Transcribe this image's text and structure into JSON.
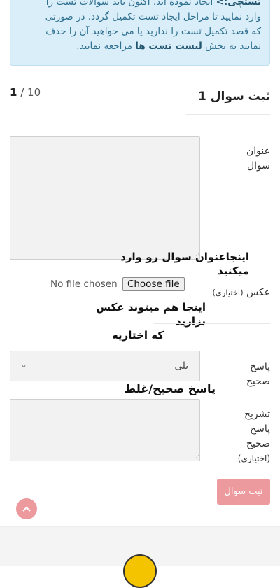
{
  "alert": {
    "line1_bold": "تستچی:>",
    "line1_rest": " ایجاد نموده اید. اکنون باید سوالات تست را",
    "line2": "وارد نمایید تا مراحل ایجاد تست تکمیل گردد. در صورتی",
    "line3": "که قصد تکمیل تست را ندارید یا می خواهید آن را حذف",
    "line4_pre": "نمایید به بخش ",
    "line4_bold": "لیست تست ها",
    "line4_post": " مراجعه نمایید."
  },
  "header": {
    "title": "ثبت سوال 1",
    "pager_total": "10",
    "pager_sep": " / ",
    "pager_current": "1"
  },
  "form": {
    "question_label_1": "عنوان",
    "question_label_2": "سوال",
    "image_label": "عکس",
    "image_label_optional": "(اختیاری)",
    "file_status": "No file chosen",
    "file_button": "Choose file",
    "answer_label_1": "پاسخ",
    "answer_label_2": "صحیح",
    "answer_selected": "بلی",
    "explain_label_1": "تشریح",
    "explain_label_2": "پاسخ",
    "explain_label_3": "صحیح",
    "explain_label_4": "(اختیاری)",
    "submit_label": "ثبت سوال"
  },
  "annotations": {
    "title_note": "اینجاعنوان سوال رو وارد میکنید",
    "image_note_1": "اینجا هم میتوند عکس بزارید",
    "image_note_2": "که اختاریه",
    "answer_note": "پاسخ صحیح/غلط"
  },
  "icons": {
    "chevron": "chevron-down-icon",
    "scroll_top": "arrow-up-icon"
  },
  "colors": {
    "alert_bg": "#d9eef8",
    "accent": "#ec9a9e"
  }
}
